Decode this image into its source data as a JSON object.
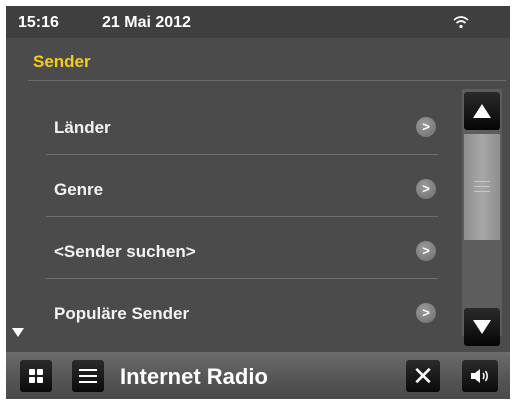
{
  "status_bar": {
    "time": "15:16",
    "date": "21 Mai 2012",
    "wifi_icon": "wifi-icon"
  },
  "header": {
    "title": "Sender",
    "title_color": "#f4cb1a"
  },
  "list": {
    "items": [
      {
        "label": "Länder",
        "arrow": ">"
      },
      {
        "label": "Genre",
        "arrow": ">"
      },
      {
        "label": "<Sender suchen>",
        "arrow": ">"
      },
      {
        "label": "Populäre Sender",
        "arrow": ">"
      }
    ],
    "more_below_icon": "triangle-down-icon"
  },
  "scrollbar": {
    "up_icon": "triangle-up-icon",
    "down_icon": "triangle-down-icon"
  },
  "bottom_bar": {
    "title": "Internet Radio",
    "apps_icon": "grid-icon",
    "menu_icon": "menu-icon",
    "close_glyph": "✕",
    "volume_icon": "speaker-icon"
  }
}
